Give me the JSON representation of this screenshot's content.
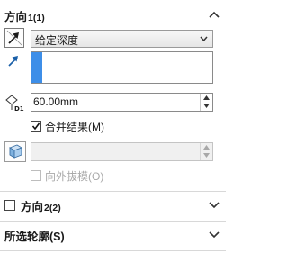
{
  "direction1": {
    "title": "方向",
    "title_num": "1(1)",
    "end_condition": {
      "selected": "给定深度"
    },
    "depth": {
      "value": "60.00mm"
    },
    "merge_result": {
      "label": "合并结果(M)",
      "checked": true
    },
    "draft_outward": {
      "label": "向外拔模(O)",
      "checked": false,
      "enabled": false
    }
  },
  "direction2": {
    "title": "方向",
    "title_num": "2(2)",
    "checked": false
  },
  "selected_contours": {
    "title": "所选轮廓(S)"
  },
  "colors": {
    "accent": "#3d8ee8",
    "divider": "#d8d8d8"
  },
  "icons": [
    "reverse-direction-icon",
    "direction-arrow-icon",
    "depth-dimension-icon",
    "draft-icon",
    "chevron-up-icon",
    "chevron-down-icon"
  ]
}
